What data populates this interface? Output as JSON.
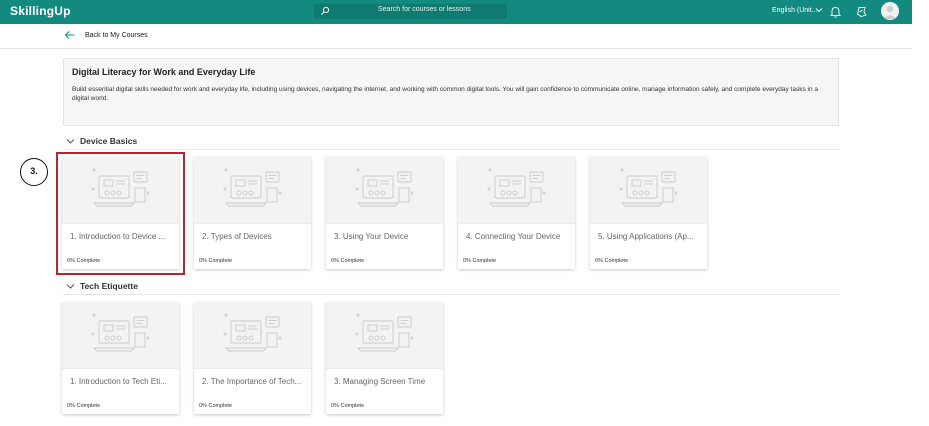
{
  "header": {
    "logo": "SkillingUp",
    "search_placeholder": "Search for courses or lessons",
    "language": "English (Unit..."
  },
  "back": {
    "label": "Back to My Courses"
  },
  "course": {
    "title": "Digital Literacy for Work and Everyday Life",
    "description": "Build essential digital skills needed for work and everyday life, including using devices, navigating the internet, and working with common digital tools. You will gain confidence to communicate online, manage information safely, and complete everyday tasks in a digital world."
  },
  "sections": [
    {
      "title": "Device Basics",
      "cards": [
        {
          "title": "1. Introduction to Device ...",
          "status": "0% Complete"
        },
        {
          "title": "2. Types of Devices",
          "status": "0% Complete"
        },
        {
          "title": "3. Using Your Device",
          "status": "0% Complete"
        },
        {
          "title": "4. Connecting Your Device",
          "status": "0% Complete"
        },
        {
          "title": "5. Using Applications (Ap...",
          "status": "0% Complete"
        }
      ]
    },
    {
      "title": "Tech Etiquette",
      "cards": [
        {
          "title": "1. Introduction to Tech Eti...",
          "status": "0% Complete"
        },
        {
          "title": "2. The Importance of Tech...",
          "status": "0% Complete"
        },
        {
          "title": "3. Managing Screen Time",
          "status": "0% Complete"
        }
      ]
    }
  ],
  "annotation": {
    "step_label": "3."
  },
  "colors": {
    "header": "#138a80",
    "highlight": "#b7252e",
    "back_arrow": "#138a80"
  },
  "icons": {
    "search": "search-icon",
    "chevron": "chevron-down-icon",
    "bell": "bell-icon",
    "badge": "badge-icon",
    "back": "arrow-left-icon",
    "thumb": "lesson-thumbnail-icon"
  }
}
